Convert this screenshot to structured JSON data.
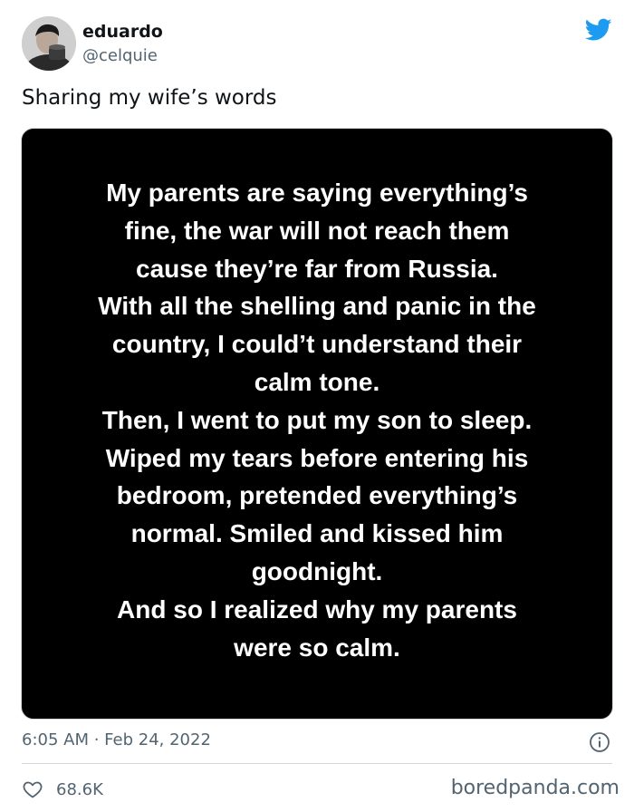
{
  "author": {
    "display_name": "eduardo",
    "handle": "@celquie",
    "avatar_icon": "avatar-photo"
  },
  "brand": {
    "icon": "twitter-bird-icon",
    "color": "#1d9bf0"
  },
  "tweet": {
    "text": "Sharing my wife’s words",
    "image_lines": [
      "My parents are saying everything’s",
      "fine, the war will not reach them",
      "cause they’re far from Russia.",
      "With all the shelling and panic in the",
      "country, I could’t understand their",
      "calm tone.",
      "Then, I went to put my son to sleep.",
      "Wiped my tears before entering his",
      "bedroom, pretended everything’s",
      "normal. Smiled and kissed him",
      "goodnight.",
      "And so I realized why my parents",
      "were so calm."
    ],
    "timestamp": "6:05 AM · Feb 24, 2022",
    "likes": "68.6K"
  },
  "watermark": "boredpanda.com",
  "colors": {
    "text_primary": "#0f1419",
    "text_secondary": "#536471",
    "media_background": "#000000"
  }
}
